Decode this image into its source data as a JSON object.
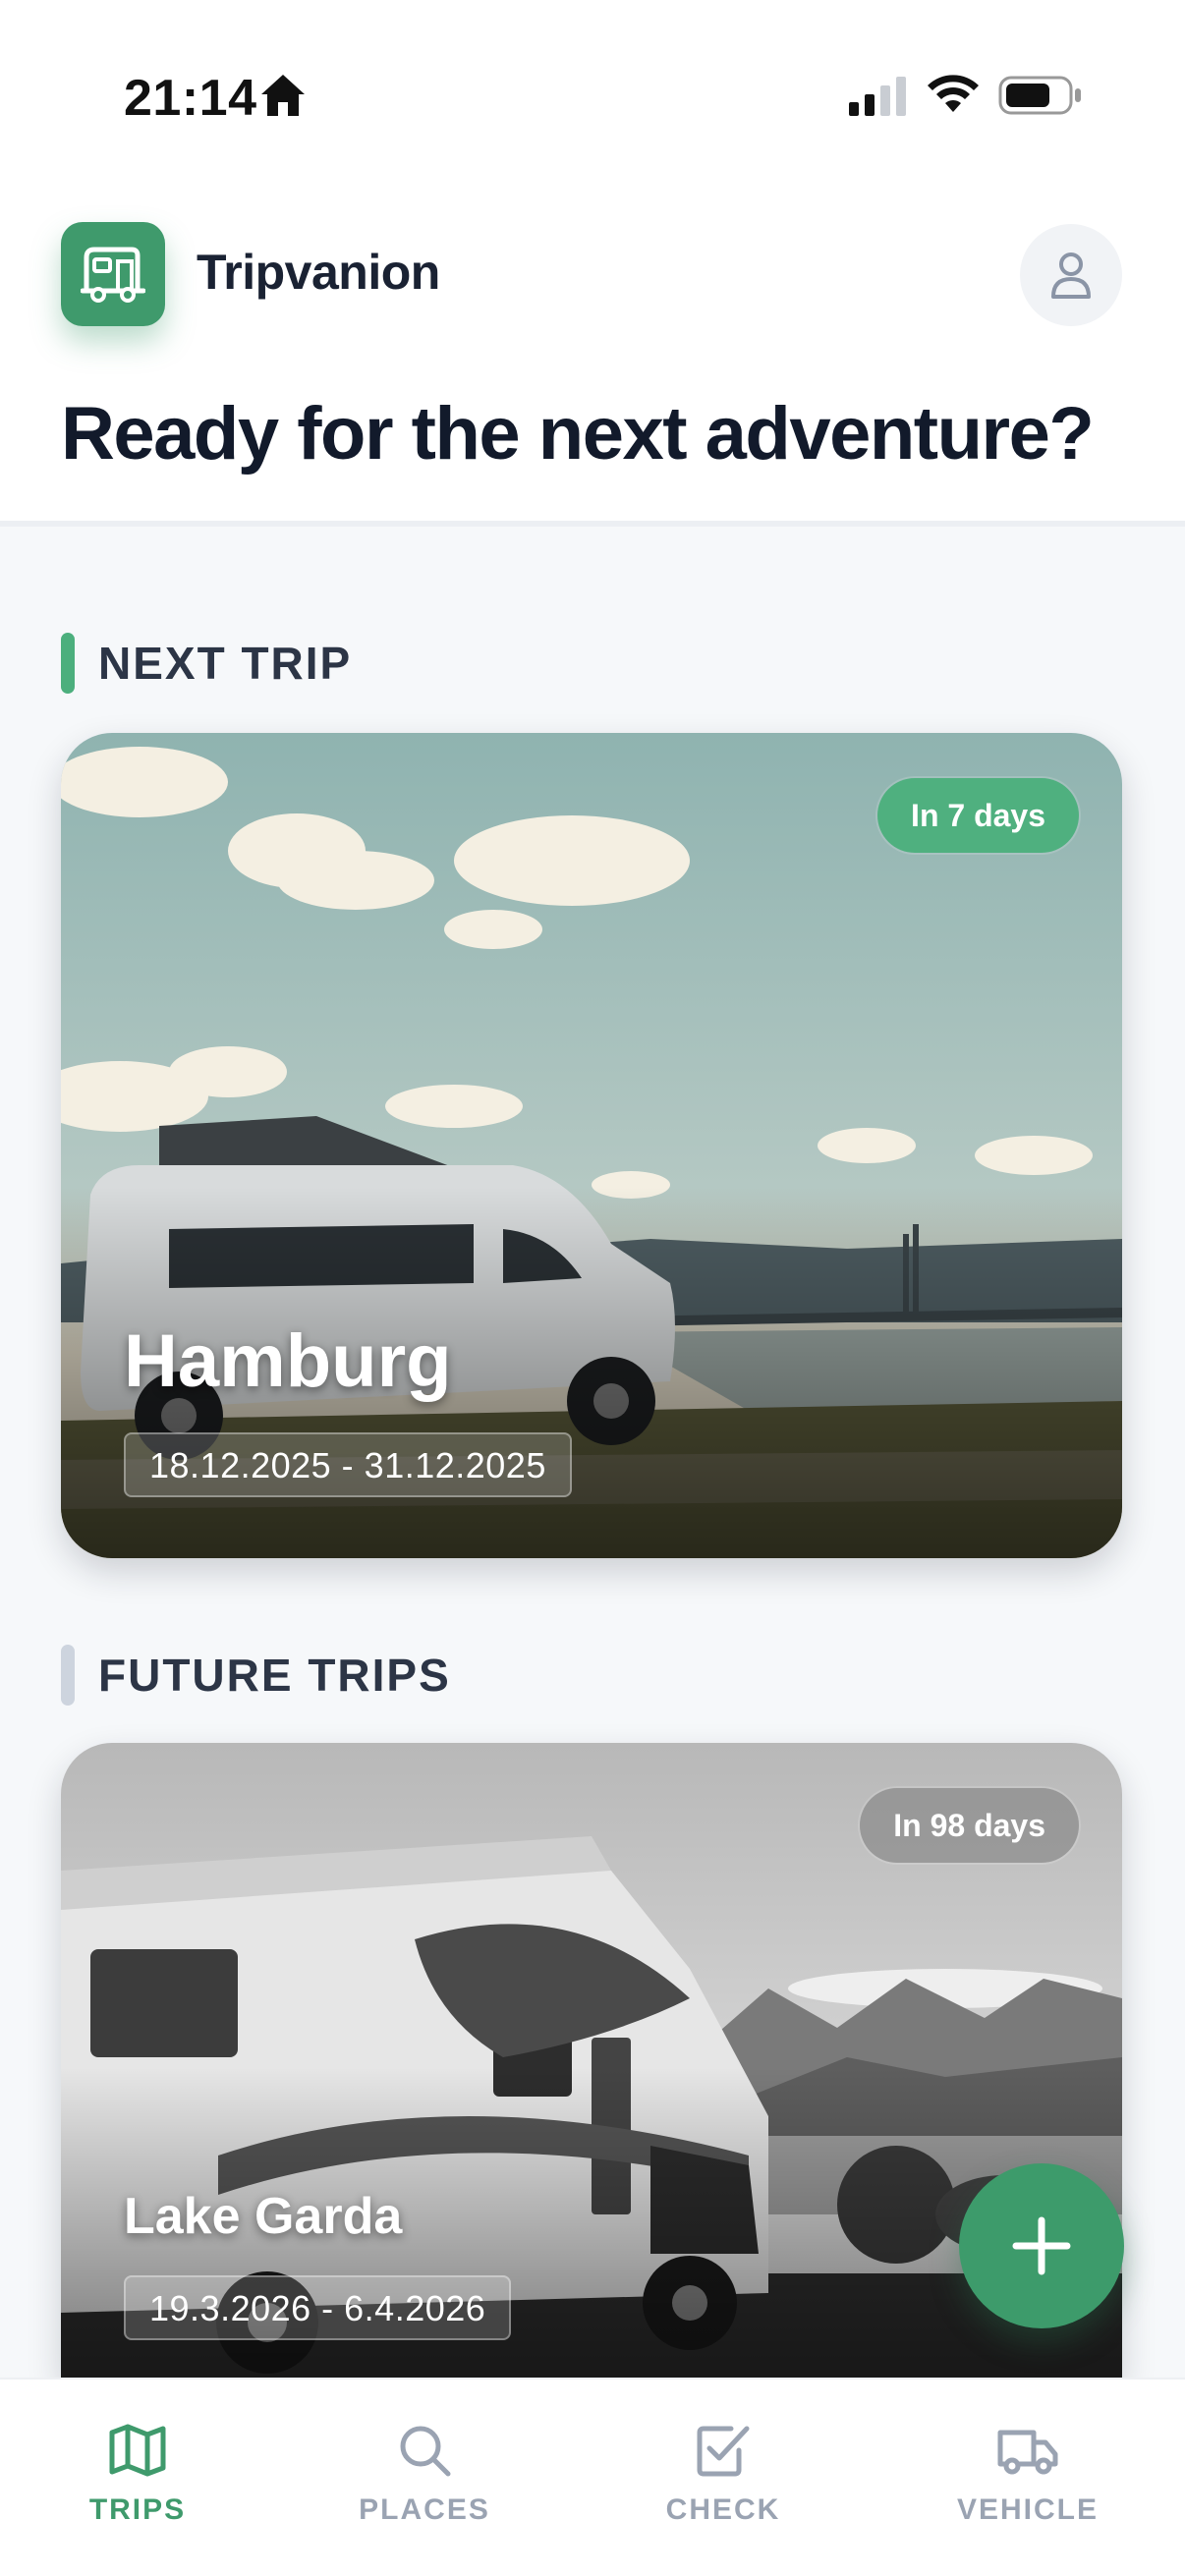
{
  "status_bar": {
    "time": "21:14",
    "icons": [
      "home-icon",
      "cellular-signal-icon",
      "wifi-icon",
      "battery-icon"
    ]
  },
  "header": {
    "app_name": "Tripvanion",
    "logo_icon": "camper-van-icon",
    "profile_icon": "user-icon",
    "headline": "Ready for the next adventure?"
  },
  "sections": {
    "next_trip": "NEXT TRIP",
    "future_trips": "FUTURE TRIPS"
  },
  "next_trip": {
    "name": "Hamburg",
    "dates": "18.12.2025 - 31.12.2025",
    "countdown": "In 7 days"
  },
  "future_trips": [
    {
      "name": "Lake Garda",
      "dates": "19.3.2026 - 6.4.2026",
      "countdown": "In 98 days"
    }
  ],
  "fab": {
    "icon": "plus-icon"
  },
  "bottom_nav": [
    {
      "label": "TRIPS",
      "icon": "map-icon",
      "active": true
    },
    {
      "label": "PLACES",
      "icon": "search-icon",
      "active": false
    },
    {
      "label": "CHECK",
      "icon": "checkbox-icon",
      "active": false
    },
    {
      "label": "VEHICLE",
      "icon": "truck-icon",
      "active": false
    }
  ],
  "colors": {
    "accent": "#3f9a6c",
    "badge_next": "#4fb07f",
    "inactive": "#9aa3b2",
    "heading": "#121a2b"
  }
}
